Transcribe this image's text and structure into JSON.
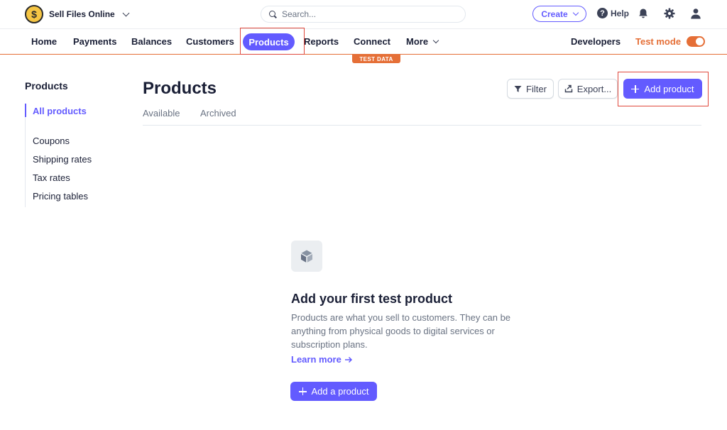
{
  "topbar": {
    "account_name": "Sell Files Online",
    "logo_glyph": "$",
    "search_placeholder": "Search...",
    "create_label": "Create",
    "help_label": "Help"
  },
  "nav": {
    "items": [
      "Home",
      "Payments",
      "Balances",
      "Customers",
      "Products",
      "Reports",
      "Connect",
      "More"
    ],
    "active": "Products",
    "developers_label": "Developers",
    "test_mode_label": "Test mode",
    "test_mode_on": true,
    "test_data_badge": "TEST DATA"
  },
  "sidebar": {
    "title": "Products",
    "items": [
      {
        "label": "All products",
        "active": true
      },
      {
        "label": "Coupons",
        "active": false
      },
      {
        "label": "Shipping rates",
        "active": false
      },
      {
        "label": "Tax rates",
        "active": false
      },
      {
        "label": "Pricing tables",
        "active": false
      }
    ]
  },
  "main": {
    "title": "Products",
    "tabs": [
      "Available",
      "Archived"
    ],
    "filter_label": "Filter",
    "export_label": "Export...",
    "add_product_label": "Add product"
  },
  "empty_state": {
    "icon": "box-icon",
    "title": "Add your first test product",
    "description": "Products are what you sell to customers. They can be anything from physical goods to digital services or subscription plans.",
    "learn_more_label": "Learn more",
    "add_button_label": "Add a product"
  },
  "colors": {
    "accent": "#635bff",
    "test_mode": "#e56f37",
    "highlight_box": "#e0483c"
  }
}
